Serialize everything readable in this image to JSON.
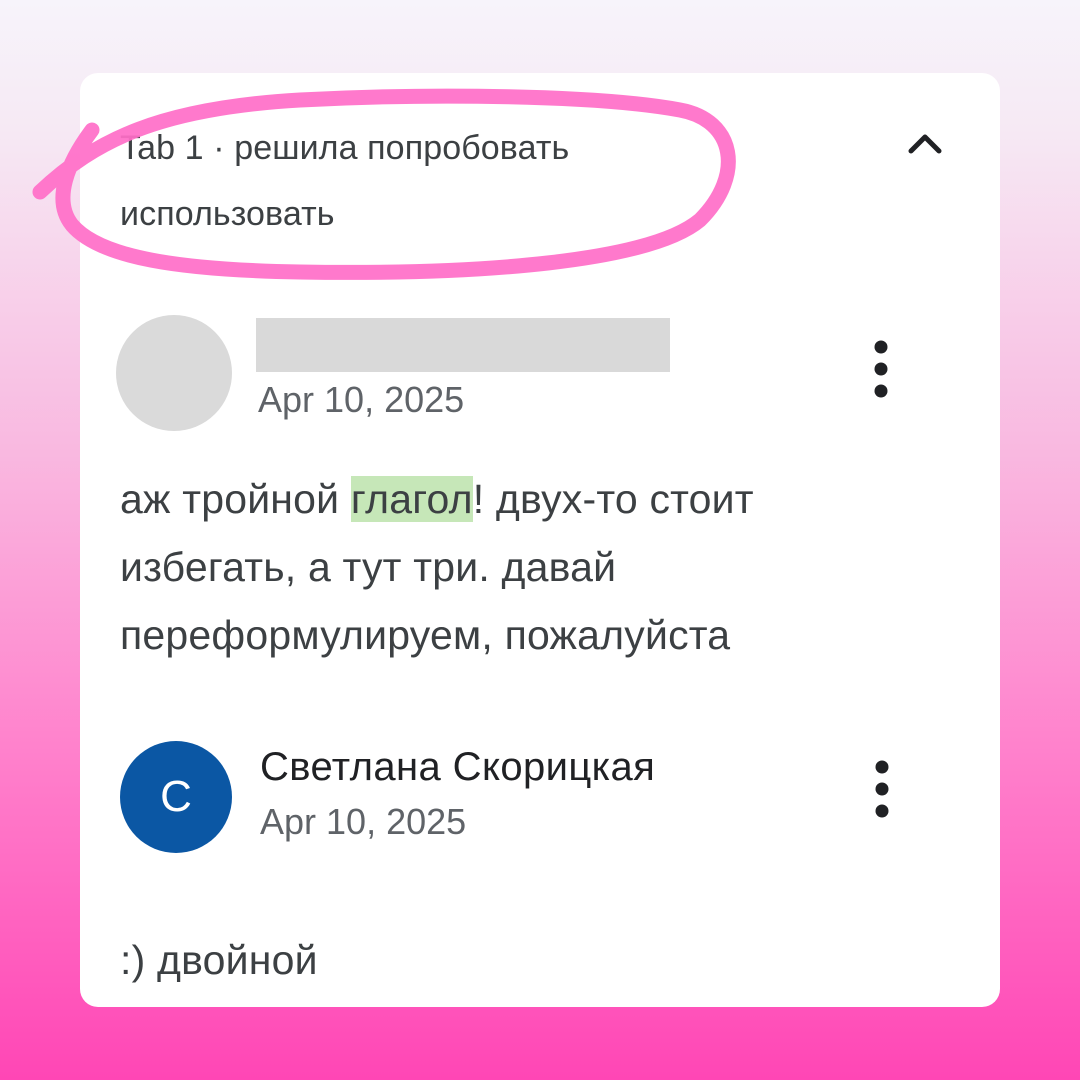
{
  "thread": {
    "header": "Tab 1 · решила попробовать использовать"
  },
  "comments": [
    {
      "author": "",
      "author_redacted": true,
      "date": "Apr 10, 2025",
      "text_before": "аж тройной ",
      "highlight": "глагол",
      "text_after": "! двух-то стоит избегать, а тут три. давай переформулируем, пожалуйста"
    },
    {
      "author": "Светлана Скорицкая",
      "avatar_initial": "С",
      "avatar_color": "#0b57a4",
      "date": "Apr 10, 2025",
      "text": ":) двойной"
    }
  ],
  "icons": {
    "collapse": "chevron-up-icon",
    "more": "more-vert-icon"
  },
  "colors": {
    "annotation": "#ff6fc8",
    "highlight": "#c6e7b8"
  }
}
